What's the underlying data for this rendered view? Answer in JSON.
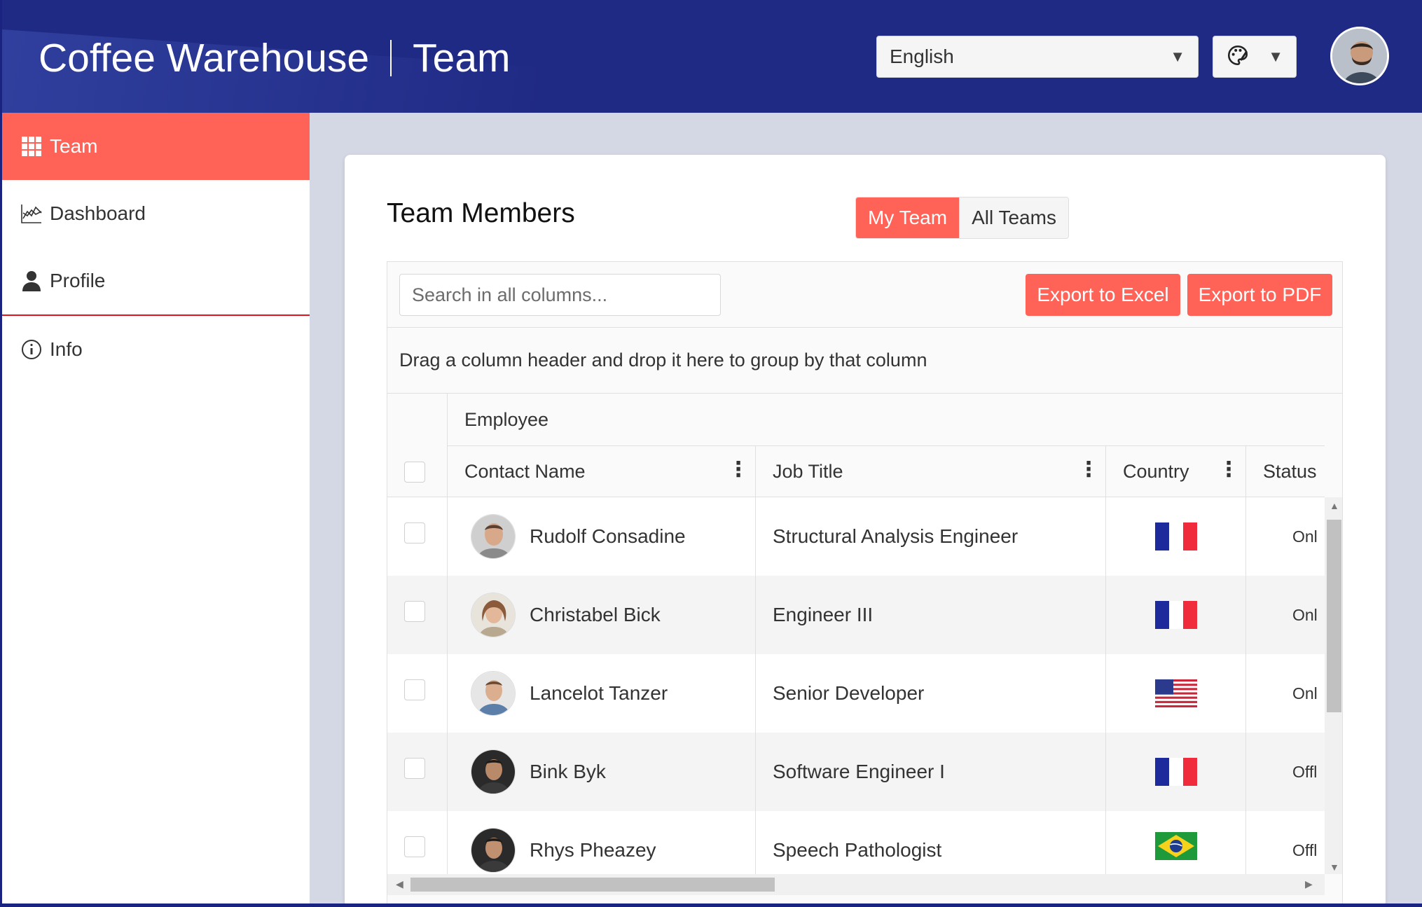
{
  "header": {
    "app_name": "Coffee Warehouse",
    "section": "Team",
    "language": "English"
  },
  "sidebar": {
    "items": [
      {
        "label": "Team",
        "icon": "grid-icon",
        "active": true
      },
      {
        "label": "Dashboard",
        "icon": "chart-icon"
      },
      {
        "label": "Profile",
        "icon": "user-icon"
      },
      {
        "label": "Info",
        "icon": "info-icon"
      }
    ]
  },
  "main": {
    "title": "Team Members",
    "tabs": [
      {
        "label": "My Team",
        "selected": true
      },
      {
        "label": "All Teams"
      }
    ],
    "search_placeholder": "Search in all columns...",
    "export_excel": "Export to Excel",
    "export_pdf": "Export to PDF",
    "group_hint": "Drag a column header and drop it here to group by that column",
    "column_group": "Employee",
    "columns": [
      "Contact Name",
      "Job Title",
      "Country",
      "Status"
    ],
    "rows": [
      {
        "name": "Rudolf Consadine",
        "job": "Structural Analysis Engineer",
        "country": "France",
        "status": "Onl"
      },
      {
        "name": "Christabel Bick",
        "job": "Engineer III",
        "country": "France",
        "status": "Onl"
      },
      {
        "name": "Lancelot Tanzer",
        "job": "Senior Developer",
        "country": "United States",
        "status": "Onl"
      },
      {
        "name": "Bink Byk",
        "job": "Software Engineer I",
        "country": "France",
        "status": "Offl"
      },
      {
        "name": "Rhys Pheazey",
        "job": "Speech Pathologist",
        "country": "Brazil",
        "status": "Offl"
      }
    ]
  },
  "colors": {
    "header_bg": "#1f2a84",
    "accent": "#ff6358",
    "page_bg": "#d4d7e4"
  }
}
